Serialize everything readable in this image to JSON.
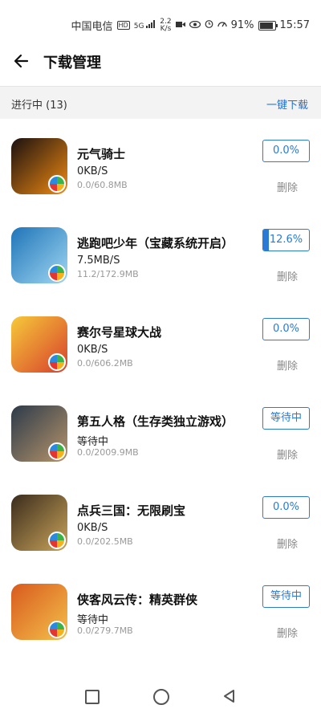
{
  "status": {
    "carrier": "中国电信",
    "hd": "HD",
    "net": "5G",
    "speed_value": "2.2",
    "speed_unit": "K/s",
    "battery": "91%",
    "battery_level": 0.91,
    "time": "15:57"
  },
  "header": {
    "title": "下载管理"
  },
  "section": {
    "label": "进行中 (13)",
    "action": "一键下载"
  },
  "items": [
    {
      "name": "元气骑士",
      "speed": "0KB/S",
      "size": "0.0/60.8MB",
      "button": "0.0%",
      "progress": 0,
      "delete": "删除",
      "icon_colors": [
        "#1a1010",
        "#f08a12"
      ]
    },
    {
      "name": "逃跑吧少年（宝藏系统开启）",
      "speed": "7.5MB/S",
      "size": "11.2/172.9MB",
      "button": "12.6%",
      "progress": 0.126,
      "delete": "删除",
      "icon_colors": [
        "#1f74b8",
        "#9fd7f2"
      ]
    },
    {
      "name": "赛尔号星球大战",
      "speed": "0KB/S",
      "size": "0.0/606.2MB",
      "button": "0.0%",
      "progress": 0,
      "delete": "删除",
      "icon_colors": [
        "#f6c93a",
        "#d8402c"
      ]
    },
    {
      "name": "第五人格（生存类独立游戏）",
      "speed": "等待中",
      "size": "0.0/2009.9MB",
      "button": "等待中",
      "progress": 0,
      "delete": "删除",
      "icon_colors": [
        "#2c3a4a",
        "#b6946a"
      ]
    },
    {
      "name": "点兵三国：无限刷宝",
      "speed": "0KB/S",
      "size": "0.0/202.5MB",
      "button": "0.0%",
      "progress": 0,
      "delete": "删除",
      "icon_colors": [
        "#3a2b1c",
        "#c9a45a"
      ]
    },
    {
      "name": "侠客风云传：精英群侠",
      "speed": "等待中",
      "size": "0.0/279.7MB",
      "button": "等待中",
      "progress": 0,
      "delete": "删除",
      "icon_colors": [
        "#d85a1e",
        "#f4c04a"
      ]
    }
  ]
}
